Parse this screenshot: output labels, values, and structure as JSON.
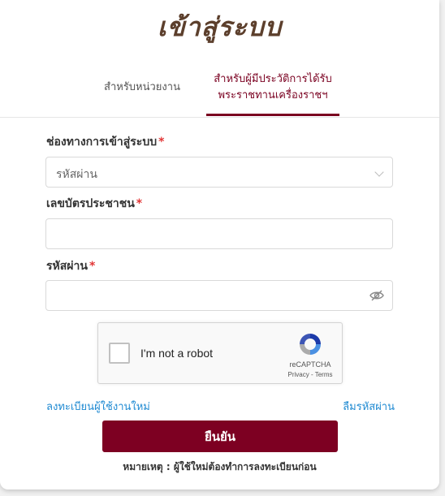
{
  "page": {
    "title": "เข้าสู่ระบบ"
  },
  "tabs": [
    {
      "label": "สำหรับหน่วยงาน",
      "active": false
    },
    {
      "label_line1": "สำหรับผู้มีประวัติการได้รับ",
      "label_line2": "พระราชทานเครื่องราชฯ",
      "active": true
    }
  ],
  "form": {
    "channel": {
      "label": "ช่องทางการเข้าสู่ระบบ",
      "required_mark": "*",
      "value": "รหัสผ่าน"
    },
    "id_card": {
      "label": "เลขบัตรประชาชน",
      "required_mark": "*",
      "value": ""
    },
    "password": {
      "label": "รหัสผ่าน",
      "required_mark": "*",
      "value": ""
    }
  },
  "captcha": {
    "checkbox_label": "I'm not a robot",
    "brand": "reCAPTCHA",
    "terms": "Privacy - Terms"
  },
  "links": {
    "register": "ลงทะเบียนผู้ใช้งานใหม่",
    "forgot_password": "ลืมรหัสผ่าน"
  },
  "submit_label": "ยืนยัน",
  "note": "หมายเหตุ : ผู้ใช้ใหม่ต้องทำการลงทะเบียนก่อน",
  "colors": {
    "brand": "#7d0022",
    "title": "#5c3f2c",
    "link": "#1f8ad2",
    "required": "#e23636"
  },
  "icons": {
    "select_caret": "chevron-down-icon",
    "password_toggle": "eye-slash-icon",
    "captcha_logo": "recaptcha-icon"
  }
}
